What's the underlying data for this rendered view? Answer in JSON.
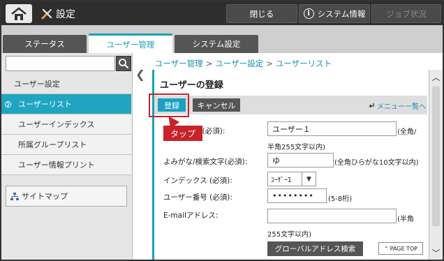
{
  "topbar": {
    "title": "設定",
    "close_label": "閉じる",
    "sysinfo_label": "システム情報",
    "sysinfo_icon": "i",
    "job_status_label": "ジョブ状況"
  },
  "tabs": [
    "ステータス",
    "ユーザー管理",
    "システム設定"
  ],
  "sidebar": {
    "search_value": "",
    "items": [
      "ユーザー設定",
      "ユーザーリスト",
      "ユーザーインデックス",
      "所属グループリスト",
      "ユーザー情報プリント"
    ],
    "sitemap_label": "サイトマップ"
  },
  "breadcrumb": [
    "ユーザー管理",
    "ユーザー設定",
    "ユーザーリスト"
  ],
  "breadcrumb_sep": ">",
  "panel": {
    "title": "ユーザーの登録",
    "register_label": "登録",
    "cancel_label": "キャンセル",
    "menu_link": "メニュー一覧へ"
  },
  "callout": {
    "text": "タップ"
  },
  "form": {
    "name_label": "ユーザー名 (必須):",
    "name_value": "ユーザー１",
    "name_note_1": "(全角/",
    "name_note_2": "半角255文字以内)",
    "kana_label": "よみがな/検索文字(必須):",
    "kana_value": "ゆ",
    "kana_note": "(全角ひらがな10文字以内)",
    "index_label": "インデックス (必須):",
    "index_value": "ﾕｰｻﾞｰ1",
    "number_label": "ユーザー番号 (必須):",
    "number_value": "••••••••",
    "number_note": "(5-8桁)",
    "email_label": "E-mailアドレス:",
    "email_value": "",
    "email_note_1": "(半角",
    "email_note_2": "255文字以内)",
    "global_btn": "グローバルアドレス検索",
    "pagetop_label": "PAGE TOP"
  },
  "colors": {
    "accent": "#1aa0b8",
    "callout": "#c8222a",
    "topbar": "#2e2e2e"
  }
}
